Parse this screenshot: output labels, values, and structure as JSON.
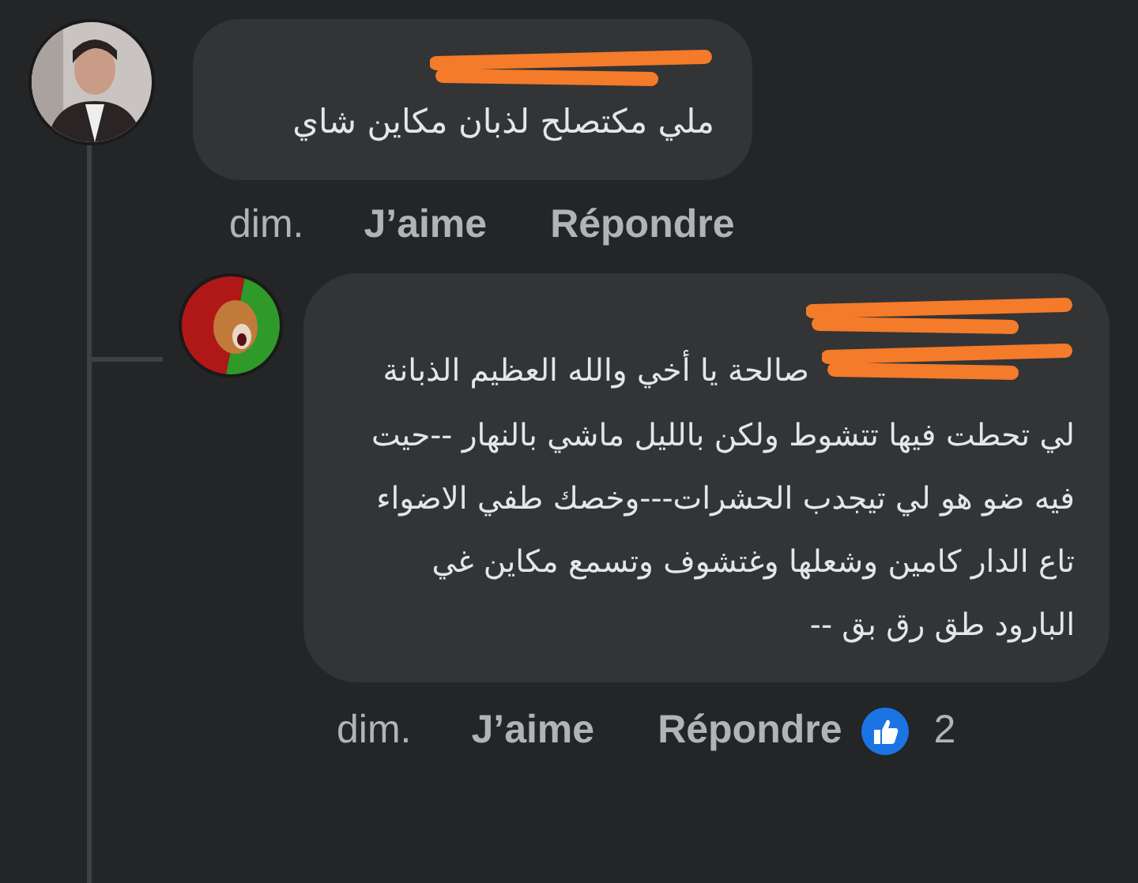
{
  "comments": [
    {
      "time": "dim.",
      "like": "J’aime",
      "reply": "Répondre",
      "text": "ملي مكتصلح لذبان مكاين شاي"
    },
    {
      "time": "dim.",
      "like": "J’aime",
      "reply": "Répondre",
      "text": "صالحة يا أخي والله العظيم الذبانة لي تحطت فيها تتشوط ولكن بالليل ماشي بالنهار --حيت فيه ضو هو لي تيجدب الحشرات---وخصك طفي الاضواء تاع الدار كامين وشعلها وغتشوف وتسمع مكاين غي البارود طق رق بق --",
      "reactions": {
        "count": "2"
      }
    }
  ]
}
